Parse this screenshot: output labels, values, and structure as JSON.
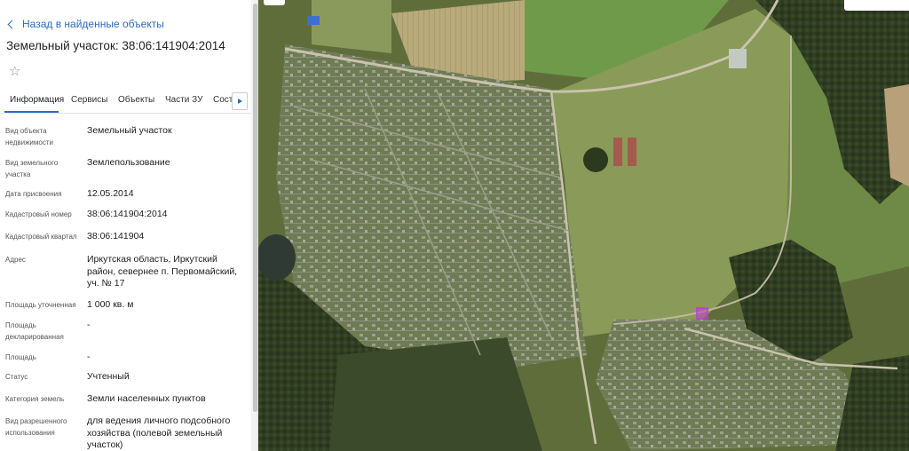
{
  "panel": {
    "back_label": "Назад в найденные объекты",
    "title": "Земельный участок: 38:06:141904:2014",
    "favorite_icon": "star-icon",
    "tabs": [
      {
        "label": "Информация",
        "active": true
      },
      {
        "label": "Сервисы",
        "active": false
      },
      {
        "label": "Объекты",
        "active": false
      },
      {
        "label": "Части ЗУ",
        "active": false
      },
      {
        "label": "Соста",
        "active": false
      }
    ],
    "accent": "#2b6cc4",
    "fields": [
      {
        "label": "Вид объекта недвижимости",
        "value": "Земельный участок"
      },
      {
        "label": "Вид земельного участка",
        "value": "Землепользование"
      },
      {
        "label": "Дата присвоения",
        "value": "12.05.2014"
      },
      {
        "label": "Кадастровый номер",
        "value": "38:06:141904:2014"
      },
      {
        "label": "Кадастровый квартал",
        "value": "38:06:141904"
      },
      {
        "label": "Адрес",
        "value": "Иркутская область, Иркутский район, севернее п. Первомайский, уч. № 17"
      },
      {
        "label": "Площадь уточненная",
        "value": "1 000 кв. м"
      },
      {
        "label": "Площадь декларированная",
        "value": "-"
      },
      {
        "label": "Площадь",
        "value": "-"
      },
      {
        "label": "Статус",
        "value": "Учтенный"
      },
      {
        "label": "Категория земель",
        "value": "Земли населенных пунктов"
      },
      {
        "label": "Вид разрешенного использования",
        "value": "для ведения личного подсобного хозяйства (полевой земельный участок)"
      }
    ]
  },
  "map": {
    "type": "satellite-imagery",
    "parcel_highlight_color": "#c23bd4"
  }
}
